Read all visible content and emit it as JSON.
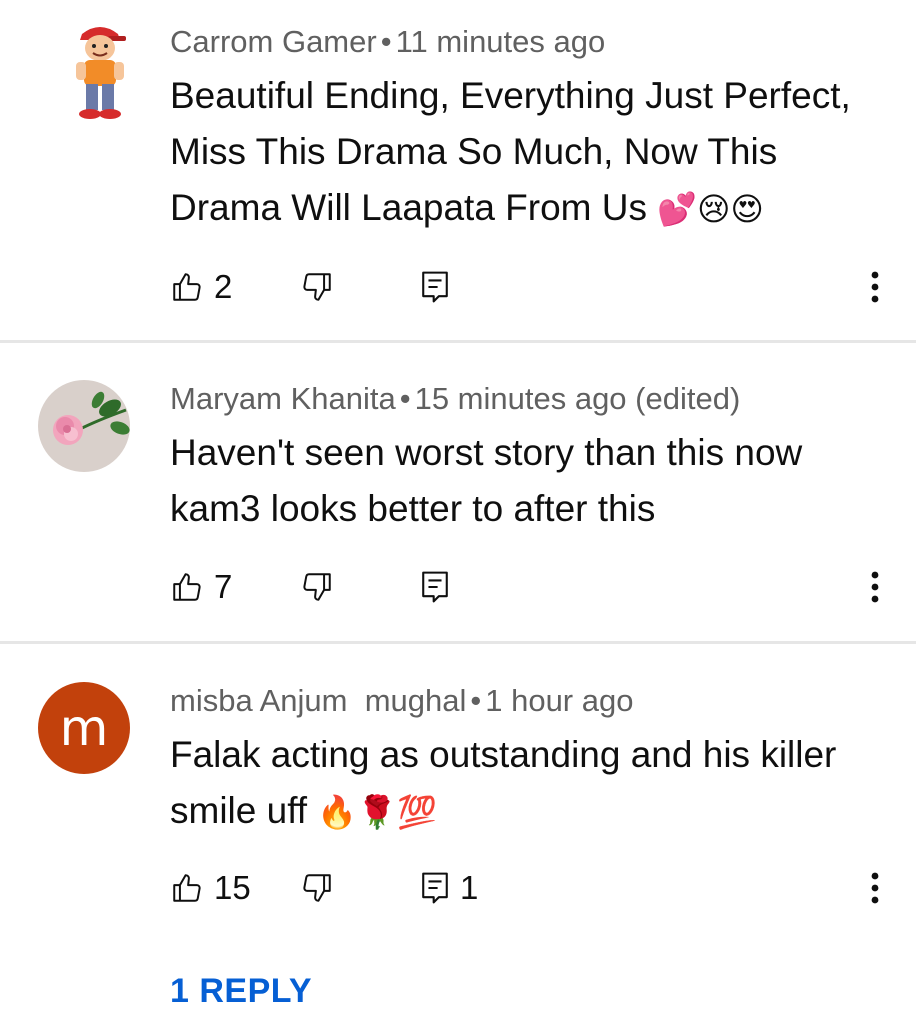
{
  "comments": [
    {
      "author": "Carrom Gamer",
      "time": "11 minutes ago",
      "text": "Beautiful Ending, Everything Just Perfect, Miss This Drama So Much, Now This Drama Will Laapata From Us",
      "emojis": "💕😢😍",
      "likes": "2",
      "replies": "",
      "avatar": "cartoon-character"
    },
    {
      "author": "Maryam Khanita",
      "time": "15 minutes ago (edited)",
      "text": "Haven't seen worst story than this now kam3 looks better to after this",
      "emojis": "",
      "likes": "7",
      "replies": "",
      "avatar": "pink-rose-photo"
    },
    {
      "author": "misba Anjum  mughal",
      "time": "1 hour ago",
      "text": "Falak acting as outstanding and his killer smile uff",
      "emojis": "🔥🌹💯",
      "likes": "15",
      "replies": "1",
      "avatar_letter": "m",
      "avatar_color": "#c2410c"
    }
  ],
  "separator": "•",
  "reply_link": "1 REPLY",
  "colors": {
    "meta": "#606060",
    "text": "#0f0f0f",
    "link": "#065fd4",
    "divider": "#e6e6e6"
  }
}
